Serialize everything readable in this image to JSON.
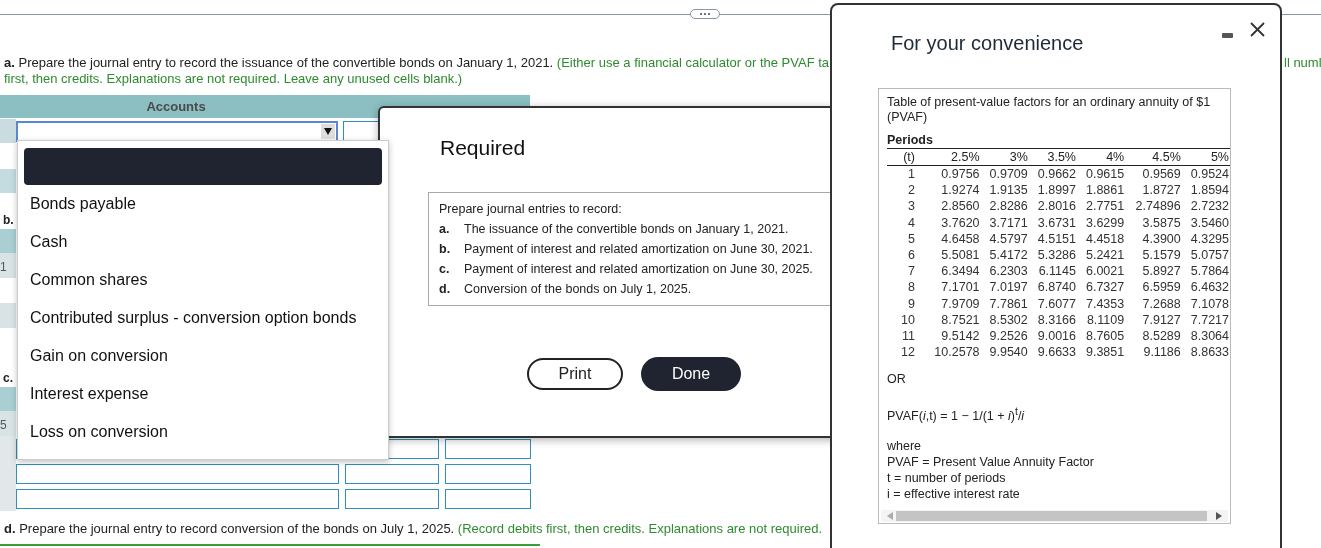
{
  "question_a": {
    "label": "a.",
    "text": "Prepare the journal entry to record the issuance of the convertible bonds on January 1, 2021.",
    "note_line_1": "(Either use a financial calculator or the PVAF ta",
    "note_line_2": "first, then credits. Explanations are not required. Leave any unused cells blank.)",
    "note_tail": "ll numl"
  },
  "journal": {
    "accounts_header": "Accounts"
  },
  "side_labels": [
    {
      "kind": "section",
      "text": "b."
    },
    {
      "kind": "row",
      "text": "1"
    },
    {
      "kind": "section",
      "text": "c."
    },
    {
      "kind": "row",
      "text": "5"
    }
  ],
  "account_dropdown": {
    "blank_option": {
      "selected": true
    },
    "options": [
      {
        "label": "Bonds payable",
        "selected": false
      },
      {
        "label": "Cash",
        "selected": false
      },
      {
        "label": "Common shares",
        "selected": false
      },
      {
        "label": "Contributed surplus - conversion option bonds",
        "selected": false
      },
      {
        "label": "Gain on conversion",
        "selected": false
      },
      {
        "label": "Interest expense",
        "selected": false
      },
      {
        "label": "Loss on conversion",
        "selected": false
      }
    ]
  },
  "question_d": {
    "label": "d.",
    "text": "Prepare the journal entry to record conversion of the bonds on July 1, 2025.",
    "note": "(Record debits first, then credits. Explanations are not required."
  },
  "required_dialog": {
    "title": "Required",
    "intro": "Prepare journal entries to record:",
    "items": [
      {
        "label": "a.",
        "text": "The issuance of the convertible bonds on January 1, 2021."
      },
      {
        "label": "b.",
        "text": "Payment of interest and related amortization on June 30, 2021."
      },
      {
        "label": "c.",
        "text": "Payment of interest and related amortization on June 30, 2025."
      },
      {
        "label": "d.",
        "text": "Conversion of the bonds on July 1, 2025."
      }
    ],
    "buttons": [
      "Print",
      "Done"
    ]
  },
  "convenience_panel": {
    "title": "For your convenience",
    "table_title": "Table of present-value factors for an ordinary annuity of $1 (PVAF)",
    "periods_label": "Periods",
    "columns": [
      "(t)",
      "2.5%",
      "3%",
      "3.5%",
      "4%",
      "4.5%",
      "5%"
    ],
    "rows": [
      [
        "1",
        "0.9756",
        "0.9709",
        "0.9662",
        "0.9615",
        "0.9569",
        "0.9524"
      ],
      [
        "2",
        "1.9274",
        "1.9135",
        "1.8997",
        "1.8861",
        "1.8727",
        "1.8594"
      ],
      [
        "3",
        "2.8560",
        "2.8286",
        "2.8016",
        "2.7751",
        "2.74896",
        "2.7232"
      ],
      [
        "4",
        "3.7620",
        "3.7171",
        "3.6731",
        "3.6299",
        "3.5875",
        "3.5460"
      ],
      [
        "5",
        "4.6458",
        "4.5797",
        "4.5151",
        "4.4518",
        "4.3900",
        "4.3295"
      ],
      [
        "6",
        "5.5081",
        "5.4172",
        "5.3286",
        "5.2421",
        "5.1579",
        "5.0757"
      ],
      [
        "7",
        "6.3494",
        "6.2303",
        "6.1145",
        "6.0021",
        "5.8927",
        "5.7864"
      ],
      [
        "8",
        "7.1701",
        "7.0197",
        "6.8740",
        "6.7327",
        "6.5959",
        "6.4632"
      ],
      [
        "9",
        "7.9709",
        "7.7861",
        "7.6077",
        "7.4353",
        "7.2688",
        "7.1078"
      ],
      [
        "10",
        "8.7521",
        "8.5302",
        "8.3166",
        "8.1109",
        "7.9127",
        "7.7217"
      ],
      [
        "11",
        "9.5142",
        "9.2526",
        "9.0016",
        "8.7605",
        "8.5289",
        "8.3064"
      ],
      [
        "12",
        "10.2578",
        "9.9540",
        "9.6633",
        "9.3851",
        "9.1186",
        "8.8633"
      ]
    ],
    "or_label": "OR",
    "formula": "PVAF(*i*,t) = 1 − 1/(1 + *i*)$^{t}$/*i*",
    "where_label": "where",
    "definitions": [
      "PVAF = Present Value Annuity Factor",
      "t = number of periods",
      "i = effective interest rate"
    ]
  }
}
